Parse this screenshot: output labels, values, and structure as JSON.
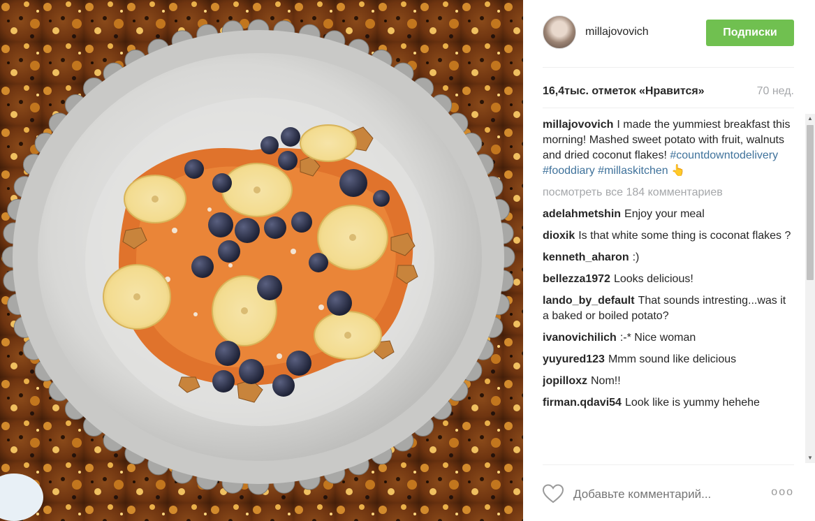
{
  "post": {
    "username": "millajovovich",
    "follow_label": "Подписки",
    "likes": "16,4тыс. отметок «Нравится»",
    "age": "70 нед.",
    "caption": {
      "user": "millajovovich",
      "text": "I made the yummiest breakfast this morning! Mashed sweet potato with fruit, walnuts and dried coconut flakes!",
      "hashtag1": "#countdowntodelivery",
      "hashtag2": "#fooddiary",
      "hashtag3": "#millaskitchen",
      "emoji": "👆"
    },
    "view_all": "посмотреть все 184 комментариев",
    "comments": [
      {
        "user": "adelahmetshin",
        "text": "Enjoy your meal"
      },
      {
        "user": "dioxik",
        "text": "Is that white some thing is coconat flakes ?"
      },
      {
        "user": "kenneth_aharon",
        "text": ":)"
      },
      {
        "user": "bellezza1972",
        "text": "Looks delicious!"
      },
      {
        "user": "lando_by_default",
        "text": "That sounds intresting...was it a baked or boiled potato?"
      },
      {
        "user": "ivanovichilich",
        "text": ":-* Nice woman"
      },
      {
        "user": "yuyured123",
        "text": "Mmm sound like delicious"
      },
      {
        "user": "jopilloxz",
        "text": "Nom!!"
      },
      {
        "user": "firman.qdavi54",
        "text": "Look like is yummy hehehe"
      }
    ],
    "add_comment_placeholder": "Добавьте комментарий...",
    "more_label": "ooo"
  },
  "colors": {
    "follow_button": "#70c050",
    "hashtag": "#3f729b",
    "muted_text": "#a5a7aa"
  },
  "icons": {
    "like": "heart-outline-icon",
    "more": "more-options-icon",
    "scroll_up": "scroll-up-arrow-icon",
    "scroll_down": "scroll-down-arrow-icon"
  }
}
